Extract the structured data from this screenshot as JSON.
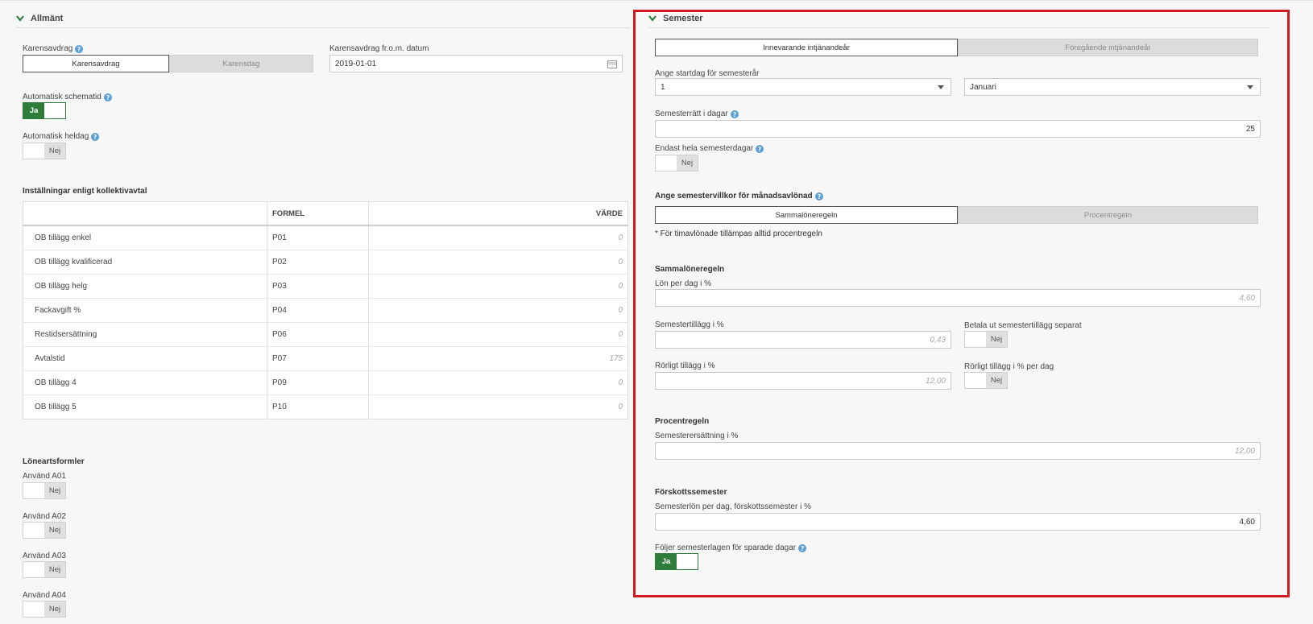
{
  "general": {
    "title": "Allmänt",
    "karensavdrag_label": "Karensavdrag",
    "karensavdrag_options": [
      "Karensavdrag",
      "Karensdag"
    ],
    "karens_date_label": "Karensavdrag fr.o.m. datum",
    "karens_date_value": "2019-01-01",
    "auto_schema_label": "Automatisk schematid",
    "auto_schema_value": "Ja",
    "auto_heldag_label": "Automatisk heldag",
    "auto_heldag_value": "Nej"
  },
  "kollektivavtal": {
    "title": "Inställningar enligt kollektivavtal",
    "headers": [
      "",
      "FORMEL",
      "VÄRDE"
    ],
    "rows": [
      {
        "name": "OB tillägg enkel",
        "formel": "P01",
        "value": "0"
      },
      {
        "name": "OB tillägg kvalificerad",
        "formel": "P02",
        "value": "0"
      },
      {
        "name": "OB tillägg helg",
        "formel": "P03",
        "value": "0"
      },
      {
        "name": "Fackavgift %",
        "formel": "P04",
        "value": "0"
      },
      {
        "name": "Restidsersättning",
        "formel": "P06",
        "value": "0"
      },
      {
        "name": "Avtalstid",
        "formel": "P07",
        "value": "175"
      },
      {
        "name": "OB tillägg 4",
        "formel": "P09",
        "value": "0"
      },
      {
        "name": "OB tillägg 5",
        "formel": "P10",
        "value": "0"
      }
    ]
  },
  "loneartsformler": {
    "title": "Löneartsformler",
    "items": [
      {
        "label": "Använd A01",
        "value": "Nej"
      },
      {
        "label": "Använd A02",
        "value": "Nej"
      },
      {
        "label": "Använd A03",
        "value": "Nej"
      },
      {
        "label": "Använd A04",
        "value": "Nej"
      }
    ]
  },
  "semester": {
    "title": "Semester",
    "year_tabs": [
      "Innevarande intjänandeår",
      "Föregående intjänandeår"
    ],
    "startday_label": "Ange startdag för semesterår",
    "startday_value": "1",
    "startmonth_value": "Januari",
    "ratt_label": "Semesterrätt i dagar",
    "ratt_value": "25",
    "hela_label": "Endast hela semesterdagar",
    "hela_value": "Nej",
    "villkor_label": "Ange semestervillkor för månadsavlönad",
    "villkor_tabs": [
      "Sammalöneregeln",
      "Procentregeln"
    ],
    "villkor_note": "* För timavlönade tillämpas alltid procentregeln",
    "samma_title": "Sammalöneregeln",
    "lon_per_dag_label": "Lön per dag i %",
    "lon_per_dag_value": "4,60",
    "tillagg_label": "Semestertillägg i %",
    "tillagg_value": "0,43",
    "betala_label": "Betala ut semestertillägg separat",
    "betala_value": "Nej",
    "rorligt_label": "Rörligt tillägg i %",
    "rorligt_value": "12,00",
    "rorligt_dag_label": "Rörligt tillägg i % per dag",
    "rorligt_dag_value": "Nej",
    "procent_title": "Procentregeln",
    "ersattning_label": "Semesterersättning i %",
    "ersattning_value": "12,00",
    "forskott_title": "Förskottssemester",
    "forskott_lon_label": "Semesterlön per dag, förskottssemester i %",
    "forskott_lon_value": "4,60",
    "foljer_label": "Följer semesterlagen för sparade dagar",
    "foljer_value": "Ja"
  },
  "colors": {
    "accent_green": "#2e7d3b",
    "highlight_red": "#d01a20",
    "help_blue": "#5a9fd4"
  }
}
